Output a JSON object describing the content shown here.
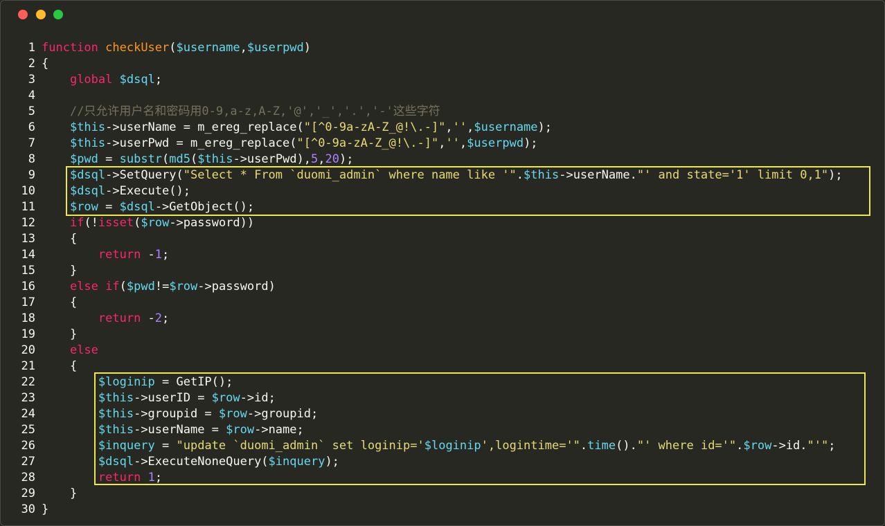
{
  "window": {
    "controls": [
      "close",
      "minimize",
      "maximize"
    ],
    "colors": {
      "close": "#fc5f57",
      "minimize": "#fdbc2e",
      "maximize": "#28c840"
    }
  },
  "theme": {
    "background": "#272822",
    "keyword": "#f92672",
    "function_name": "#fd971f",
    "variable": "#66d9ef",
    "string": "#e6db74",
    "number": "#ae81ff",
    "comment": "#75715e",
    "text": "#f8f8f2",
    "highlight_box": "#f0e84a"
  },
  "highlights": [
    {
      "from_line": 9,
      "to_line": 11
    },
    {
      "from_line": 22,
      "to_line": 28
    }
  ],
  "code": [
    {
      "n": "1",
      "tokens": [
        [
          "kw",
          "function"
        ],
        [
          "p",
          " "
        ],
        [
          "fn",
          "checkUser"
        ],
        [
          "p",
          "("
        ],
        [
          "var",
          "$username"
        ],
        [
          "p",
          ","
        ],
        [
          "var",
          "$userpwd"
        ],
        [
          "p",
          ")"
        ]
      ]
    },
    {
      "n": "2",
      "tokens": [
        [
          "p",
          "{"
        ]
      ]
    },
    {
      "n": "3",
      "tokens": [
        [
          "p",
          "    "
        ],
        [
          "kw",
          "global"
        ],
        [
          "p",
          " "
        ],
        [
          "var",
          "$dsql"
        ],
        [
          "p",
          ";"
        ]
      ]
    },
    {
      "n": "4",
      "tokens": []
    },
    {
      "n": "5",
      "tokens": [
        [
          "p",
          "    "
        ],
        [
          "cmt",
          "//只允许用户名和密码用0-9,a-z,A-Z,'@','_','.','-'这些字符"
        ]
      ]
    },
    {
      "n": "6",
      "tokens": [
        [
          "p",
          "    "
        ],
        [
          "var",
          "$this"
        ],
        [
          "p",
          "->userName = m_ereg_replace("
        ],
        [
          "str",
          "\"[^0-9a-zA-Z_@!\\.-]\""
        ],
        [
          "p",
          ","
        ],
        [
          "str",
          "''"
        ],
        [
          "p",
          ","
        ],
        [
          "var",
          "$username"
        ],
        [
          "p",
          ");"
        ]
      ]
    },
    {
      "n": "7",
      "tokens": [
        [
          "p",
          "    "
        ],
        [
          "var",
          "$this"
        ],
        [
          "p",
          "->userPwd = m_ereg_replace("
        ],
        [
          "str",
          "\"[^0-9a-zA-Z_@!\\.-]\""
        ],
        [
          "p",
          ","
        ],
        [
          "str",
          "''"
        ],
        [
          "p",
          ","
        ],
        [
          "var",
          "$userpwd"
        ],
        [
          "p",
          ");"
        ]
      ]
    },
    {
      "n": "8",
      "tokens": [
        [
          "p",
          "    "
        ],
        [
          "var",
          "$pwd"
        ],
        [
          "p",
          " = "
        ],
        [
          "bi",
          "substr"
        ],
        [
          "p",
          "("
        ],
        [
          "bi",
          "md5"
        ],
        [
          "p",
          "("
        ],
        [
          "var",
          "$this"
        ],
        [
          "p",
          "->userPwd),"
        ],
        [
          "num",
          "5"
        ],
        [
          "p",
          ","
        ],
        [
          "num",
          "20"
        ],
        [
          "p",
          ");"
        ]
      ]
    },
    {
      "n": "9",
      "tokens": [
        [
          "p",
          "    "
        ],
        [
          "var",
          "$dsql"
        ],
        [
          "p",
          "->SetQuery("
        ],
        [
          "str",
          "\"Select * From `duomi_admin` where name like '\""
        ],
        [
          "p",
          "."
        ],
        [
          "var",
          "$this"
        ],
        [
          "p",
          "->userName."
        ],
        [
          "str",
          "\"' and state='1' limit 0,1\""
        ],
        [
          "p",
          ");"
        ]
      ]
    },
    {
      "n": "10",
      "tokens": [
        [
          "p",
          "    "
        ],
        [
          "var",
          "$dsql"
        ],
        [
          "p",
          "->Execute();"
        ]
      ]
    },
    {
      "n": "11",
      "tokens": [
        [
          "p",
          "    "
        ],
        [
          "var",
          "$row"
        ],
        [
          "p",
          " = "
        ],
        [
          "var",
          "$dsql"
        ],
        [
          "p",
          "->GetObject();"
        ]
      ]
    },
    {
      "n": "12",
      "tokens": [
        [
          "p",
          "    "
        ],
        [
          "kw",
          "if"
        ],
        [
          "p",
          "(!"
        ],
        [
          "kw",
          "isset"
        ],
        [
          "p",
          "("
        ],
        [
          "var",
          "$row"
        ],
        [
          "p",
          "->password))"
        ]
      ]
    },
    {
      "n": "13",
      "tokens": [
        [
          "p",
          "    {"
        ]
      ]
    },
    {
      "n": "14",
      "tokens": [
        [
          "p",
          "        "
        ],
        [
          "kw",
          "return"
        ],
        [
          "p",
          " -"
        ],
        [
          "num",
          "1"
        ],
        [
          "p",
          ";"
        ]
      ]
    },
    {
      "n": "15",
      "tokens": [
        [
          "p",
          "    }"
        ]
      ]
    },
    {
      "n": "16",
      "tokens": [
        [
          "p",
          "    "
        ],
        [
          "kw",
          "else"
        ],
        [
          "p",
          " "
        ],
        [
          "kw",
          "if"
        ],
        [
          "p",
          "("
        ],
        [
          "var",
          "$pwd"
        ],
        [
          "p",
          "!="
        ],
        [
          "var",
          "$row"
        ],
        [
          "p",
          "->password)"
        ]
      ]
    },
    {
      "n": "17",
      "tokens": [
        [
          "p",
          "    {"
        ]
      ]
    },
    {
      "n": "18",
      "tokens": [
        [
          "p",
          "        "
        ],
        [
          "kw",
          "return"
        ],
        [
          "p",
          " -"
        ],
        [
          "num",
          "2"
        ],
        [
          "p",
          ";"
        ]
      ]
    },
    {
      "n": "19",
      "tokens": [
        [
          "p",
          "    }"
        ]
      ]
    },
    {
      "n": "20",
      "tokens": [
        [
          "p",
          "    "
        ],
        [
          "kw",
          "else"
        ]
      ]
    },
    {
      "n": "21",
      "tokens": [
        [
          "p",
          "    {"
        ]
      ]
    },
    {
      "n": "22",
      "tokens": [
        [
          "p",
          "        "
        ],
        [
          "var",
          "$loginip"
        ],
        [
          "p",
          " = GetIP();"
        ]
      ]
    },
    {
      "n": "23",
      "tokens": [
        [
          "p",
          "        "
        ],
        [
          "var",
          "$this"
        ],
        [
          "p",
          "->userID = "
        ],
        [
          "var",
          "$row"
        ],
        [
          "p",
          "->id;"
        ]
      ]
    },
    {
      "n": "24",
      "tokens": [
        [
          "p",
          "        "
        ],
        [
          "var",
          "$this"
        ],
        [
          "p",
          "->groupid = "
        ],
        [
          "var",
          "$row"
        ],
        [
          "p",
          "->groupid;"
        ]
      ]
    },
    {
      "n": "25",
      "tokens": [
        [
          "p",
          "        "
        ],
        [
          "var",
          "$this"
        ],
        [
          "p",
          "->userName = "
        ],
        [
          "var",
          "$row"
        ],
        [
          "p",
          "->name;"
        ]
      ]
    },
    {
      "n": "26",
      "tokens": [
        [
          "p",
          "        "
        ],
        [
          "var",
          "$inquery"
        ],
        [
          "p",
          " = "
        ],
        [
          "str",
          "\"update `duomi_admin` set loginip='"
        ],
        [
          "var",
          "$loginip"
        ],
        [
          "str",
          "',logintime='\""
        ],
        [
          "p",
          "."
        ],
        [
          "bi",
          "time"
        ],
        [
          "p",
          "()."
        ],
        [
          "str",
          "\"' where id='\""
        ],
        [
          "p",
          "."
        ],
        [
          "var",
          "$row"
        ],
        [
          "p",
          "->id."
        ],
        [
          "str",
          "\"'\""
        ],
        [
          "p",
          ";"
        ]
      ]
    },
    {
      "n": "27",
      "tokens": [
        [
          "p",
          "        "
        ],
        [
          "var",
          "$dsql"
        ],
        [
          "p",
          "->ExecuteNoneQuery("
        ],
        [
          "var",
          "$inquery"
        ],
        [
          "p",
          ");"
        ]
      ]
    },
    {
      "n": "28",
      "tokens": [
        [
          "p",
          "        "
        ],
        [
          "kw",
          "return"
        ],
        [
          "p",
          " "
        ],
        [
          "num",
          "1"
        ],
        [
          "p",
          ";"
        ]
      ]
    },
    {
      "n": "29",
      "tokens": [
        [
          "p",
          "    }"
        ]
      ]
    },
    {
      "n": "30",
      "tokens": [
        [
          "p",
          "}"
        ]
      ]
    }
  ]
}
